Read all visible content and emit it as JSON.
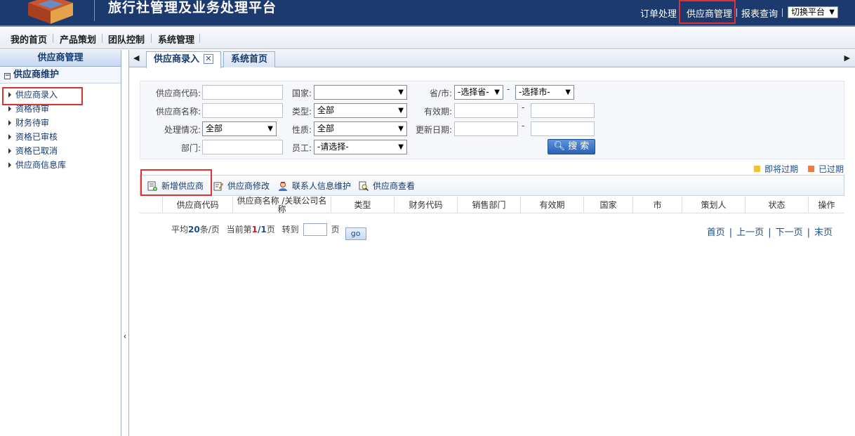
{
  "app": {
    "title": "旅行社管理及业务处理平台"
  },
  "topnav": {
    "items": [
      "订单处理",
      "供应商管理",
      "报表查询"
    ],
    "switch_platform": "切换平台"
  },
  "menubar": {
    "items": [
      "我的首页",
      "产品策划",
      "团队控制",
      "系统管理"
    ]
  },
  "sidebar": {
    "header": "供应商管理",
    "group": "供应商维护",
    "items": [
      "供应商录入",
      "资格待审",
      "财务待审",
      "资格已审核",
      "资格已取消",
      "供应商信息库"
    ]
  },
  "tabs": [
    {
      "label": "供应商录入",
      "active": true
    },
    {
      "label": "系统首页",
      "active": false
    }
  ],
  "search": {
    "labels": {
      "code": "供应商代码:",
      "name": "供应商名称:",
      "status": "处理情况:",
      "dept": "部门:",
      "country": "国家:",
      "type": "类型:",
      "nature": "性质:",
      "staff": "员工:",
      "province_city": "省/市:",
      "valid_period": "有效期:",
      "update_date": "更新日期:"
    },
    "values": {
      "code": "",
      "name": "",
      "dept": "",
      "country": "",
      "type": "全部",
      "status": "全部",
      "nature": "全部",
      "staff": "-请选择-",
      "province": "-选择省-",
      "city": "-选择市-",
      "valid_from": "",
      "valid_to": "",
      "update_from": "",
      "update_to": ""
    },
    "range_sep": "-",
    "button": "搜 索"
  },
  "legend": {
    "soon_expired": "即将过期",
    "expired": "已过期",
    "soon_color": "#f0c23b",
    "expired_color": "#ee7b3f"
  },
  "toolbar": {
    "add": "新增供应商",
    "edit": "供应商修改",
    "contacts": "联系人信息维护",
    "view": "供应商查看"
  },
  "grid": {
    "columns": [
      "供应商代码",
      "供应商名称 /关联公司名称",
      "类型",
      "财务代码",
      "销售部门",
      "有效期",
      "国家",
      "市",
      "策划人",
      "状态",
      "操作"
    ]
  },
  "pager": {
    "avg": "平均",
    "per_page_num": "20",
    "per_page_unit": "条/页",
    "current": "当前第",
    "page_cur": "1",
    "page_sep": "/",
    "page_total": "1",
    "page_unit": "页",
    "goto": "转到",
    "goto_unit": "页",
    "go": "go",
    "first": "首页",
    "prev": "上一页",
    "next": "下一页",
    "last": "末页",
    "nav_sep": "|"
  },
  "colors": {
    "header_bg": "#1d3a6e",
    "highlight": "#e0312f",
    "link": "#1a4d8f"
  }
}
